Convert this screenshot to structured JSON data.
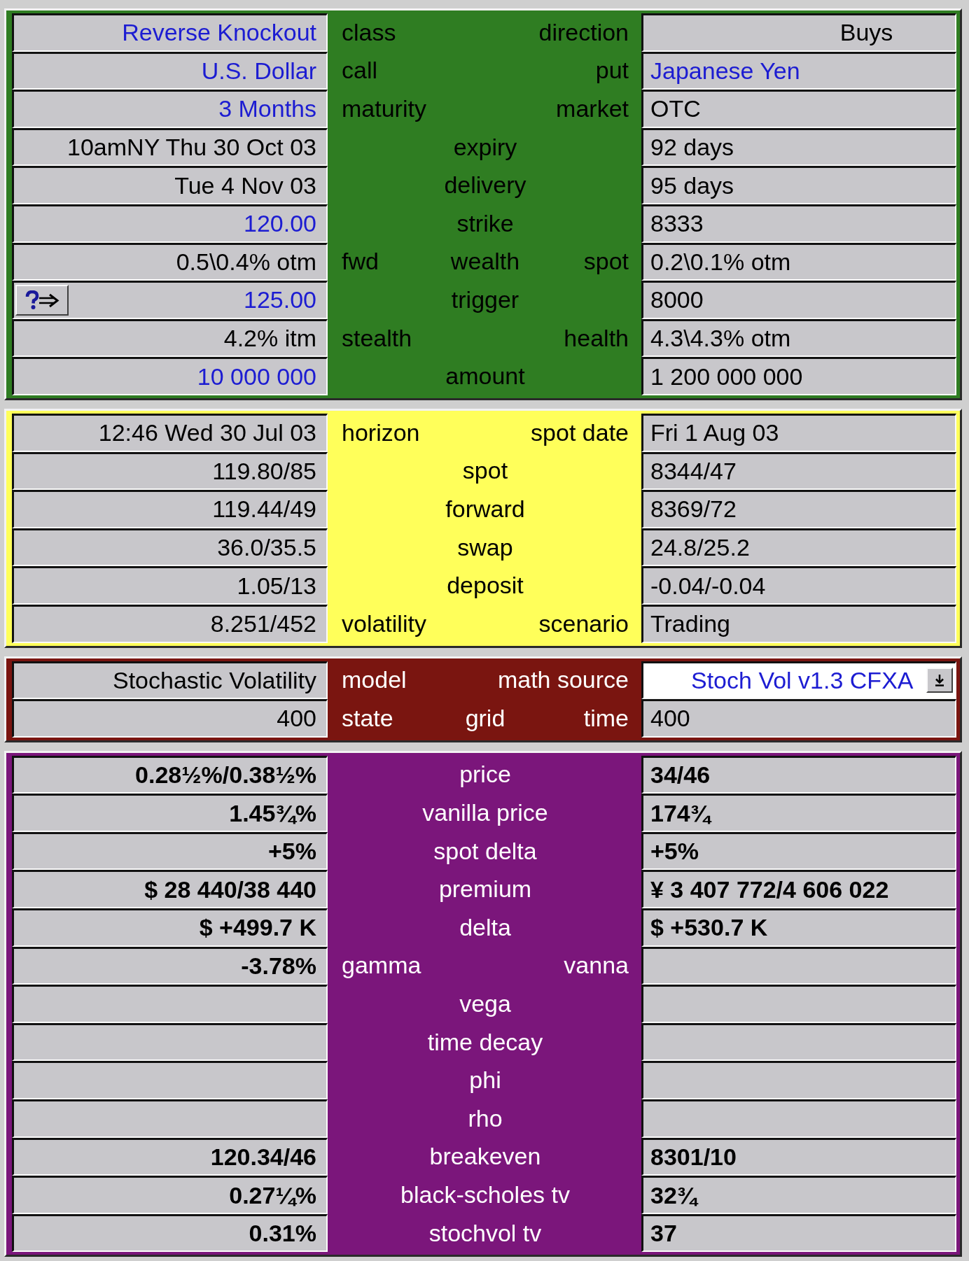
{
  "sections": [
    {
      "color": "#2f7d22",
      "bold": false,
      "rows": [
        {
          "left": {
            "kind": "field",
            "text": "Reverse Knockout",
            "input": true
          },
          "label_left": "class",
          "label_right": "direction",
          "right": {
            "kind": "choice",
            "text": "Buys",
            "input": false
          }
        },
        {
          "left": {
            "kind": "field",
            "text": "U.S. Dollar",
            "input": true
          },
          "label_left": "call",
          "label_right": "put",
          "right": {
            "kind": "field",
            "text": "Japanese Yen",
            "input": true
          }
        },
        {
          "left": {
            "kind": "field",
            "text": "3 Months",
            "input": true
          },
          "label_left": "maturity",
          "label_right": "market",
          "right": {
            "kind": "field",
            "text": "OTC",
            "input": false
          }
        },
        {
          "left": {
            "kind": "field",
            "text": "10amNY Thu 30 Oct 03",
            "input": false
          },
          "label_center": "expiry",
          "right": {
            "kind": "field",
            "text": "92 days",
            "input": false
          }
        },
        {
          "left": {
            "kind": "field",
            "text": "Tue 4 Nov 03",
            "input": false
          },
          "label_center": "delivery",
          "right": {
            "kind": "field",
            "text": "95 days",
            "input": false
          }
        },
        {
          "left": {
            "kind": "field",
            "text": "120.00",
            "input": true
          },
          "label_center": "strike",
          "right": {
            "kind": "field",
            "text": "8333",
            "input": false
          }
        },
        {
          "left": {
            "kind": "field",
            "text": "0.5\\0.4% otm",
            "input": false
          },
          "label_left": "fwd",
          "label_center": "wealth",
          "label_right": "spot",
          "right": {
            "kind": "field",
            "text": "0.2\\0.1% otm",
            "input": false
          }
        },
        {
          "left": {
            "kind": "field",
            "text": "125.00",
            "input": true,
            "help_button": true
          },
          "label_center": "trigger",
          "right": {
            "kind": "field",
            "text": "8000",
            "input": false
          }
        },
        {
          "left": {
            "kind": "field",
            "text": "4.2% itm",
            "input": false
          },
          "label_left": "stealth",
          "label_right": "health",
          "right": {
            "kind": "field",
            "text": "4.3\\4.3% otm",
            "input": false
          }
        },
        {
          "left": {
            "kind": "field",
            "text": "10 000 000",
            "input": true
          },
          "label_center": "amount",
          "right": {
            "kind": "field",
            "text": "1 200 000 000",
            "input": false
          }
        }
      ]
    },
    {
      "color": "#ffff5a",
      "bold": false,
      "rows": [
        {
          "left": {
            "kind": "field",
            "text": "12:46 Wed 30 Jul 03",
            "input": false
          },
          "label_left": "horizon",
          "label_right": "spot date",
          "right": {
            "kind": "field",
            "text": "Fri 1 Aug 03",
            "input": false
          }
        },
        {
          "left": {
            "kind": "field",
            "text": "119.80/85",
            "input": false
          },
          "label_center": "spot",
          "right": {
            "kind": "field",
            "text": "8344/47",
            "input": false
          }
        },
        {
          "left": {
            "kind": "field",
            "text": "119.44/49",
            "input": false
          },
          "label_center": "forward",
          "right": {
            "kind": "field",
            "text": "8369/72",
            "input": false
          }
        },
        {
          "left": {
            "kind": "field",
            "text": "36.0/35.5",
            "input": false
          },
          "label_center": "swap",
          "right": {
            "kind": "field",
            "text": "24.8/25.2",
            "input": false
          }
        },
        {
          "left": {
            "kind": "field",
            "text": "1.05/13",
            "input": false
          },
          "label_center": "deposit",
          "right": {
            "kind": "field",
            "text": "-0.04/-0.04",
            "input": false
          }
        },
        {
          "left": {
            "kind": "field",
            "text": "8.251/452",
            "input": false
          },
          "label_left": "volatility",
          "label_right": "scenario",
          "right": {
            "kind": "field",
            "text": "Trading",
            "input": false
          }
        }
      ]
    },
    {
      "color": "#7a1510",
      "bold": false,
      "rows": [
        {
          "left": {
            "kind": "field",
            "text": "Stochastic Volatility",
            "input": false
          },
          "label_left": "model",
          "label_right": "math source",
          "right": {
            "kind": "dropdown",
            "text": "Stoch Vol v1.3 CFXA",
            "input": true
          }
        },
        {
          "left": {
            "kind": "field",
            "text": "400",
            "input": false
          },
          "label_left": "state",
          "label_center": "grid",
          "label_right": "time",
          "right": {
            "kind": "field",
            "text": "400",
            "input": false
          }
        }
      ]
    },
    {
      "color": "#7b167b",
      "bold": true,
      "rows": [
        {
          "left": {
            "kind": "field",
            "text": "0.28½%/0.38½%",
            "input": false
          },
          "label_center": "price",
          "right": {
            "kind": "field",
            "text": "34/46",
            "input": false
          }
        },
        {
          "left": {
            "kind": "field",
            "text": "1.45¾%",
            "input": false
          },
          "label_center": "vanilla price",
          "right": {
            "kind": "field",
            "text": "174¾",
            "input": false
          }
        },
        {
          "left": {
            "kind": "field",
            "text": "+5%",
            "input": false
          },
          "label_center": "spot delta",
          "right": {
            "kind": "field",
            "text": "+5%",
            "input": false
          }
        },
        {
          "left": {
            "kind": "field",
            "text": "$ 28 440/38 440",
            "input": false
          },
          "label_center": "premium",
          "right": {
            "kind": "field",
            "text": "¥ 3 407 772/4 606 022",
            "input": false
          }
        },
        {
          "left": {
            "kind": "field",
            "text": "$ +499.7 K",
            "input": false
          },
          "label_center": "delta",
          "right": {
            "kind": "field",
            "text": "$ +530.7 K",
            "input": false
          }
        },
        {
          "left": {
            "kind": "field",
            "text": "-3.78%",
            "input": false
          },
          "label_left": "gamma",
          "label_right": "vanna",
          "right": {
            "kind": "field"
          }
        },
        {
          "left": {
            "kind": "field"
          },
          "label_center": "vega",
          "right": {
            "kind": "field"
          }
        },
        {
          "left": {
            "kind": "field"
          },
          "label_center": "time decay",
          "right": {
            "kind": "field"
          }
        },
        {
          "left": {
            "kind": "field"
          },
          "label_center": "phi",
          "right": {
            "kind": "field"
          }
        },
        {
          "left": {
            "kind": "field"
          },
          "label_center": "rho",
          "right": {
            "kind": "field"
          }
        },
        {
          "left": {
            "kind": "field",
            "text": "120.34/46",
            "input": false
          },
          "label_center": "breakeven",
          "right": {
            "kind": "field",
            "text": "8301/10",
            "input": false
          }
        },
        {
          "left": {
            "kind": "field",
            "text": "0.27¼%",
            "input": false
          },
          "label_center": "black-scholes tv",
          "right": {
            "kind": "field",
            "text": "32¾",
            "input": false
          }
        },
        {
          "left": {
            "kind": "field",
            "text": "0.31%",
            "input": false
          },
          "label_center": "stochvol tv",
          "right": {
            "kind": "field",
            "text": "37",
            "input": false
          }
        }
      ]
    }
  ]
}
